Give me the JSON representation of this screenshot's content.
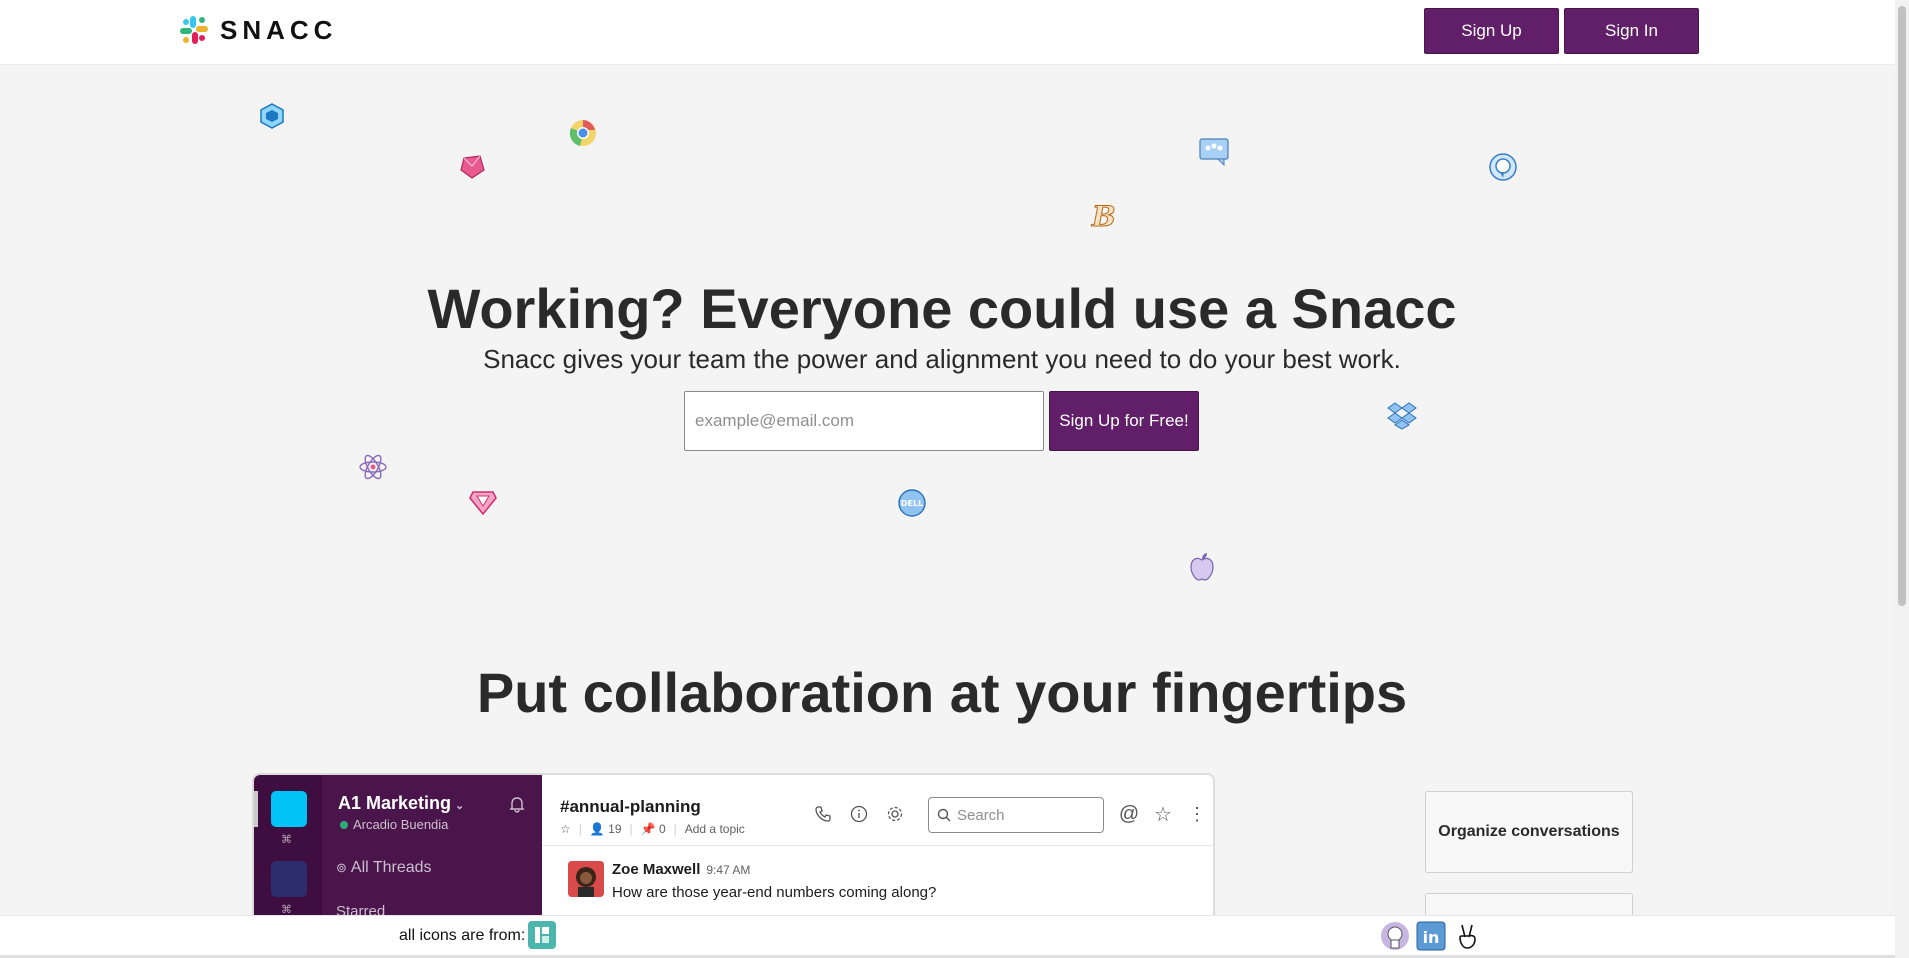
{
  "header": {
    "logo_text": "SNACC",
    "signup_label": "Sign Up",
    "signin_label": "Sign In"
  },
  "hero": {
    "title": "Working? Everyone could use a Snacc",
    "subtitle": "Snacc gives your team the power and alignment you need to do your best work.",
    "email_placeholder": "example@email.com",
    "cta_label": "Sign Up for Free!"
  },
  "floating_icons": [
    "webpack-icon",
    "ruby-icon",
    "chrome-icon",
    "team-chat-icon",
    "bootstrap-icon",
    "amazon-alexa-icon",
    "dropbox-icon",
    "react-icon",
    "gem-icon",
    "dell-icon",
    "apple-icon"
  ],
  "section": {
    "title": "Put collaboration at your fingertips"
  },
  "mock_app": {
    "team_name": "A1 Marketing",
    "user_name": "Arcadio Buendia",
    "all_threads": "All Threads",
    "starred": "Starred",
    "channel_name": "#annual-planning",
    "member_count": "19",
    "pin_count": "0",
    "add_topic": "Add a topic",
    "search_placeholder": "Search",
    "message": {
      "author": "Zoe Maxwell",
      "time": "9:47 AM",
      "text": "How are those year-end numbers coming along?"
    }
  },
  "features": [
    "Organize conversations",
    ""
  ],
  "footer": {
    "credit_text": "all icons are from:",
    "social_icons": [
      "github-icon",
      "linkedin-icon",
      "angellist-icon"
    ]
  },
  "colors": {
    "brand_purple": "#611f69",
    "sidebar_purple": "#4a154b",
    "rail_purple": "#3f0e40",
    "background": "#f4f4f4"
  }
}
